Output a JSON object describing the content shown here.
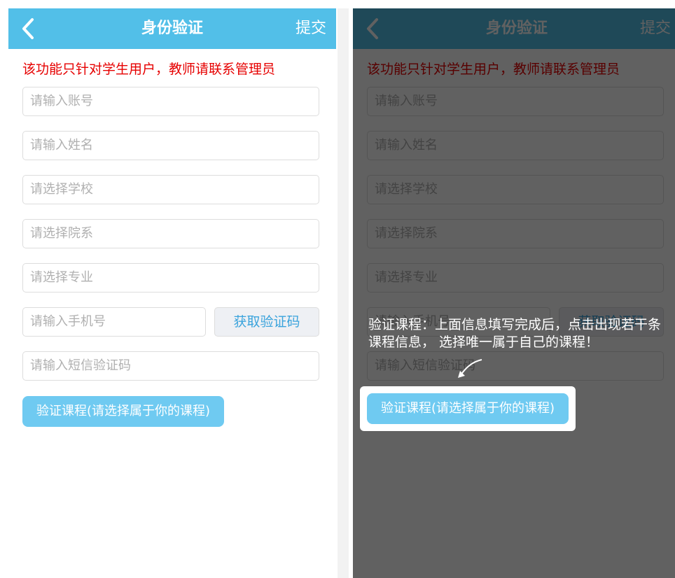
{
  "screen": {
    "title": "身份验证",
    "submit_label": "提交",
    "notice": "该功能只针对学生用户，教师请联系管理员",
    "fields": {
      "account_placeholder": "请输入账号",
      "name_placeholder": "请输入姓名",
      "school_placeholder": "请选择学校",
      "department_placeholder": "请选择院系",
      "major_placeholder": "请选择专业",
      "phone_placeholder": "请输入手机号",
      "sms_code_placeholder": "请输入短信验证码"
    },
    "get_code_label": "获取验证码",
    "verify_course_label": "验证课程(请选择属于你的课程)"
  },
  "overlay": {
    "tip_text": "验证课程：上面信息填写完成后，点击出现若干条课程信息， 选择唯一属于自己的课程！"
  },
  "colors": {
    "header": "#52bfe8",
    "notice": "#e60000",
    "primary_button": "#6fcaf1",
    "link_text": "#3aa3dc"
  },
  "icons": {
    "back": "chevron-left-icon",
    "pointer": "curved-arrow-icon"
  }
}
